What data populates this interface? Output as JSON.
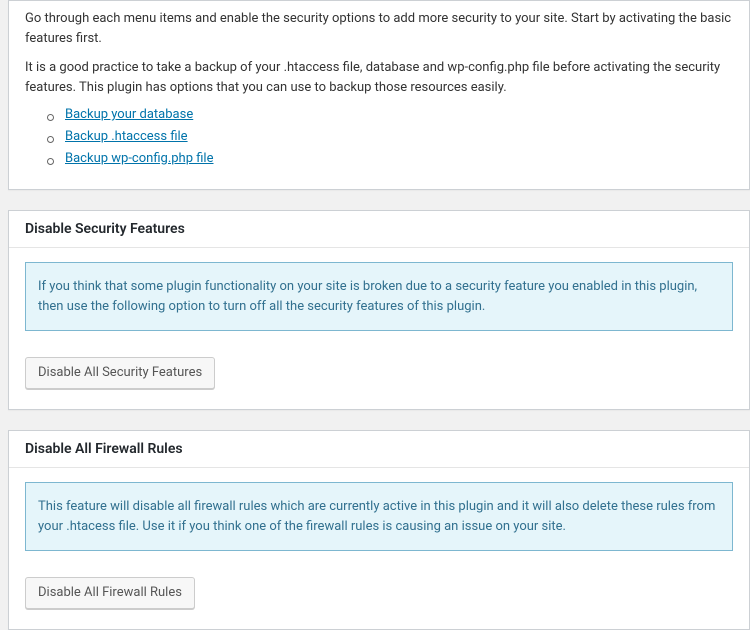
{
  "intro": {
    "line1": "Go through each menu items and enable the security options to add more security to your site. Start by activating the basic features first.",
    "line2": "It is a good practice to take a backup of your .htaccess file, database and wp-config.php file before activating the security features. This plugin has options that you can use to backup those resources easily.",
    "backup_links": {
      "db": "Backup your database",
      "htaccess": "Backup .htaccess file",
      "wpconfig": "Backup wp-config.php file"
    }
  },
  "disable_security": {
    "heading": "Disable Security Features",
    "info_text": "If you think that some plugin functionality on your site is broken due to a security feature you enabled in this plugin, then use the following option to turn off all the security features of this plugin.",
    "button": "Disable All Security Features"
  },
  "disable_firewall": {
    "heading": "Disable All Firewall Rules",
    "info_text": "This feature will disable all firewall rules which are currently active in this plugin and it will also delete these rules from your .htacess file. Use it if you think one of the firewall rules is causing an issue on your site.",
    "button": "Disable All Firewall Rules"
  }
}
